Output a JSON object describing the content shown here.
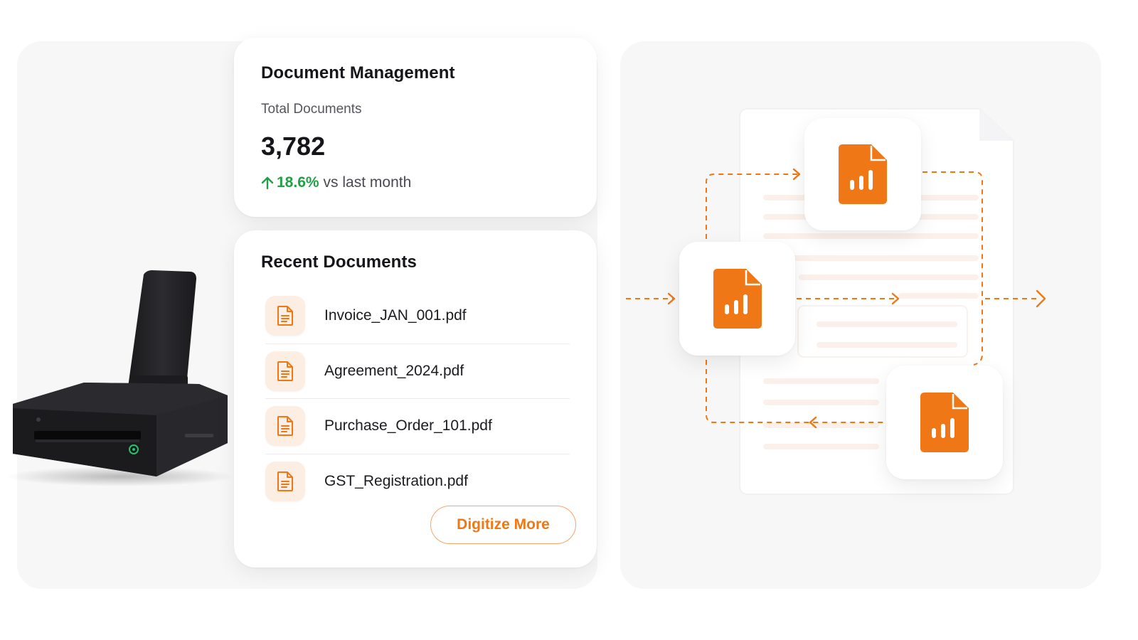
{
  "stats": {
    "title": "Document Management",
    "label": "Total Documents",
    "value": "3,782",
    "change": "18.6%",
    "change_suffix": "vs last month",
    "change_color": "#23a047"
  },
  "recent": {
    "title": "Recent Documents",
    "documents": [
      {
        "name": "Invoice_JAN_001.pdf",
        "icon": "document-icon"
      },
      {
        "name": "Agreement_2024.pdf",
        "icon": "document-icon"
      },
      {
        "name": "Purchase_Order_101.pdf",
        "icon": "document-icon"
      },
      {
        "name": "GST_Registration.pdf",
        "icon": "document-icon"
      }
    ],
    "action_label": "Digitize More"
  },
  "illustration": {
    "device": "document-scanner",
    "flow_icons": [
      "file-chart-icon",
      "file-chart-icon",
      "file-chart-icon"
    ]
  },
  "colors": {
    "accent": "#f07716",
    "accent_soft": "#fdeee3",
    "positive": "#23a047",
    "panel_bg": "#f7f7f8"
  }
}
